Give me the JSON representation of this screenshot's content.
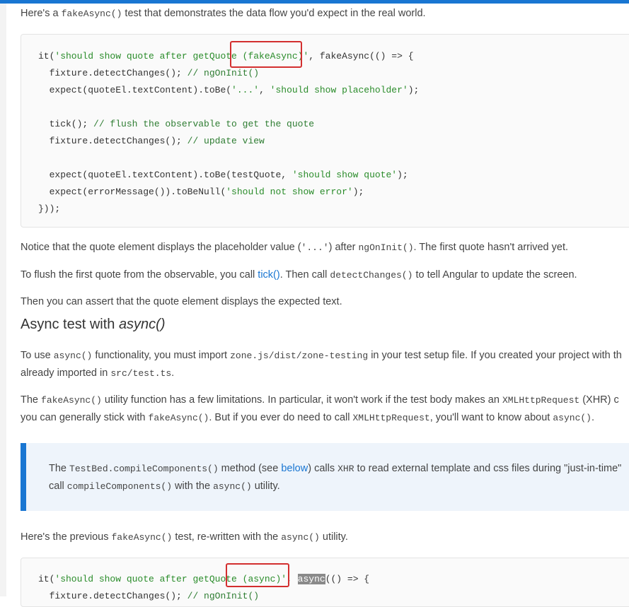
{
  "intro": {
    "pre": "Here's a ",
    "code": "fakeAsync()",
    "post": " test that demonstrates the data flow you'd expect in the real world."
  },
  "code1": {
    "lines": [
      "it('should show quote after getQuote (fakeAsync)', fakeAsync(() => {",
      "  fixture.detectChanges(); // ngOnInit()",
      "  expect(quoteEl.textContent).toBe('...', 'should show placeholder');",
      "",
      "  tick(); // flush the observable to get the quote",
      "  fixture.detectChanges(); // update view",
      "",
      "  expect(quoteEl.textContent).toBe(testQuote, 'should show quote');",
      "  expect(errorMessage()).toBeNull('should not show error');",
      "}));"
    ]
  },
  "p1": {
    "a": "Notice that the quote element displays the placeholder value (",
    "code1": "'...'",
    "b": ") after ",
    "code2": "ngOnInit()",
    "c": ". The first quote hasn't arrived yet."
  },
  "p2": {
    "a": "To flush the first quote from the observable, you call ",
    "link": "tick()",
    "b": ". Then call ",
    "code": "detectChanges()",
    "c": " to tell Angular to update the screen."
  },
  "p3": {
    "text": "Then you can assert that the quote element displays the expected text."
  },
  "heading": {
    "plain": "Async test with ",
    "italic": "async()"
  },
  "p4": {
    "a": "To use ",
    "code1": "async()",
    "b": " functionality, you must import ",
    "code2": "zone.js/dist/zone-testing",
    "c": " in your test setup file. If you created your project with th",
    "d": "already imported in ",
    "code3": "src/test.ts",
    "e": "."
  },
  "p5": {
    "a": "The ",
    "code1": "fakeAsync()",
    "b": " utility function has a few limitations. In particular, it won't work if the test body makes an ",
    "code2": "XMLHttpRequest",
    "c": " (XHR) c",
    "d": "you can generally stick with ",
    "code3": "fakeAsync()",
    "e": ". But if you ever do need to call ",
    "code4": "XMLHttpRequest",
    "f": ", you'll want to know about ",
    "code5": "async()",
    "g": "."
  },
  "callout": {
    "a": "The ",
    "code1": "TestBed.compileComponents()",
    "b": " method (see ",
    "link": "below",
    "c": ") calls ",
    "code2": "XHR",
    "d": " to read external template and css files during \"just-in-time\"",
    "e": "call ",
    "code3": "compileComponents()",
    "f": " with the ",
    "code4": "async()",
    "g": " utility."
  },
  "p6": {
    "a": "Here's the previous ",
    "code1": "fakeAsync()",
    "b": " test, re-written with the ",
    "code2": "async()",
    "c": " utility."
  },
  "code2": {
    "line1_a": "it('should show quote after getQuote (async)', ",
    "line1_sel": "async",
    "line1_b": "(() => {",
    "line2": "  fixture.detectChanges(); // ngOnInit()"
  },
  "colors": {
    "accent": "#1976d2",
    "highlight_box": "#d32f2f",
    "string": "#2a8c2a",
    "comment": "#2e7d32"
  }
}
